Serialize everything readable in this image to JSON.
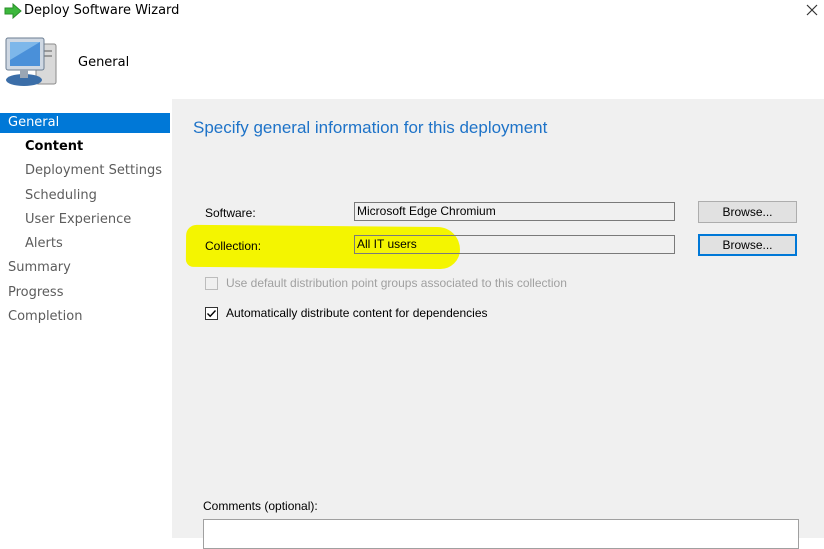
{
  "window": {
    "title": "Deploy Software Wizard"
  },
  "header": {
    "title": "General"
  },
  "sidebar": {
    "items": [
      {
        "label": "General"
      },
      {
        "label": "Content"
      },
      {
        "label": "Deployment Settings"
      },
      {
        "label": "Scheduling"
      },
      {
        "label": "User Experience"
      },
      {
        "label": "Alerts"
      },
      {
        "label": "Summary"
      },
      {
        "label": "Progress"
      },
      {
        "label": "Completion"
      }
    ]
  },
  "main": {
    "heading": "Specify general information for this deployment",
    "software": {
      "label": "Software:",
      "value": "Microsoft Edge Chromium",
      "browse": "Browse..."
    },
    "collection": {
      "label": "Collection:",
      "value": "All IT users",
      "browse": "Browse..."
    },
    "use_default_dp": {
      "label": "Use default distribution point groups associated to this collection",
      "checked": false,
      "enabled": false
    },
    "auto_distribute": {
      "label": "Automatically distribute content for dependencies",
      "checked": true,
      "enabled": true
    },
    "comments": {
      "label": "Comments (optional):",
      "value": ""
    }
  },
  "colors": {
    "accent": "#0078d7",
    "heading": "#1e73c8",
    "highlight": "#f4f500",
    "panel": "#f0f0f0"
  }
}
